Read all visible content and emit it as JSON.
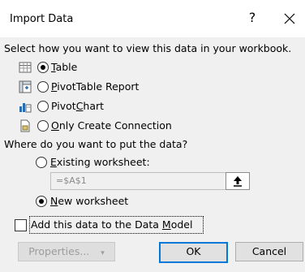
{
  "dialog": {
    "title": "Import Data",
    "help_glyph": "?",
    "close_glyph": "×"
  },
  "view_section": {
    "heading": "Select how you want to view this data in your workbook.",
    "options": [
      {
        "label": "Table",
        "mnemonic": "T",
        "rest": "able",
        "selected": true,
        "icon": "table-icon"
      },
      {
        "label": "PivotTable Report",
        "mnemonic": "P",
        "rest": "ivotTable Report",
        "selected": false,
        "icon": "pivottable-icon"
      },
      {
        "label": "PivotChart",
        "pre": "Pivot",
        "mnemonic": "C",
        "rest": "hart",
        "selected": false,
        "icon": "pivotchart-icon"
      },
      {
        "label": "Only Create Connection",
        "mnemonic": "O",
        "rest": "nly Create Connection",
        "selected": false,
        "icon": "connection-icon"
      }
    ]
  },
  "location_section": {
    "heading": "Where do you want to put the data?",
    "existing": {
      "label": "Existing worksheet:",
      "mnemonic": "E",
      "rest": "xisting worksheet:",
      "selected": false
    },
    "range_value": "=$A$1",
    "new": {
      "label": "New worksheet",
      "mnemonic": "N",
      "rest": "ew worksheet",
      "selected": true
    }
  },
  "data_model": {
    "label": "Add this data to the Data Model",
    "pre": "Add this data to the Data ",
    "mnemonic": "M",
    "rest": "odel",
    "checked": false
  },
  "buttons": {
    "properties": "Properties...",
    "ok": "OK",
    "cancel": "Cancel"
  },
  "colors": {
    "accent": "#0078d7",
    "background": "#f0f0f0"
  }
}
